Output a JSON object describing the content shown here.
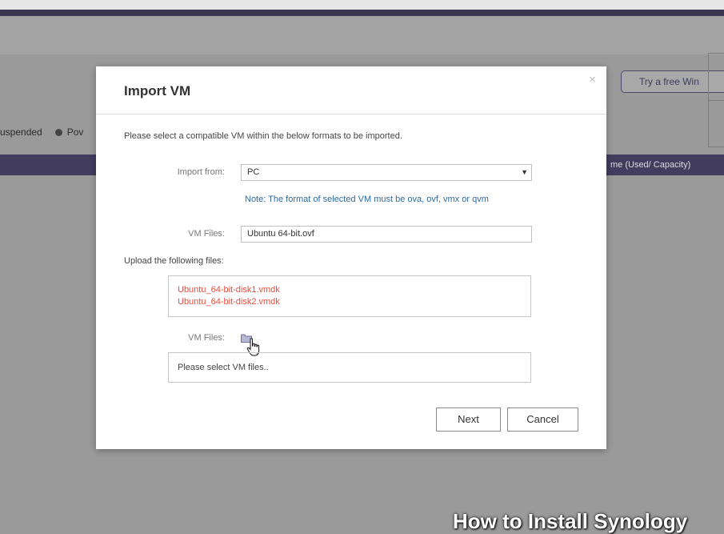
{
  "background": {
    "status_legend": [
      "uspended",
      "Pov"
    ],
    "table_header_right": "me (Used/ Capacity)",
    "try_button": "Try a free Win",
    "watermark": "How to Install Synology"
  },
  "dialog": {
    "title": "Import VM",
    "close_symbol": "×",
    "instruction": "Please select a compatible VM within the below formats to be imported.",
    "import_from_label": "Import from:",
    "import_from_value": "PC",
    "note": "Note: The format of selected VM must be ova, ovf, vmx or qvm",
    "vm_files_label": "VM Files:",
    "vm_files_value": "Ubuntu 64-bit.ovf",
    "upload_label": "Upload the following files:",
    "upload_files": [
      "Ubuntu_64-bit-disk1.vmdk",
      "Ubuntu_64-bit-disk2.vmdk"
    ],
    "vm_files_label_2": "VM Files:",
    "folder_icon": "folder-icon",
    "select_placeholder": "Please select VM files..",
    "next_label": "Next",
    "cancel_label": "Cancel"
  },
  "colors": {
    "accent_purple": "#423c5f",
    "error_red": "#e84d3d",
    "note_blue": "#2e6a9e"
  }
}
